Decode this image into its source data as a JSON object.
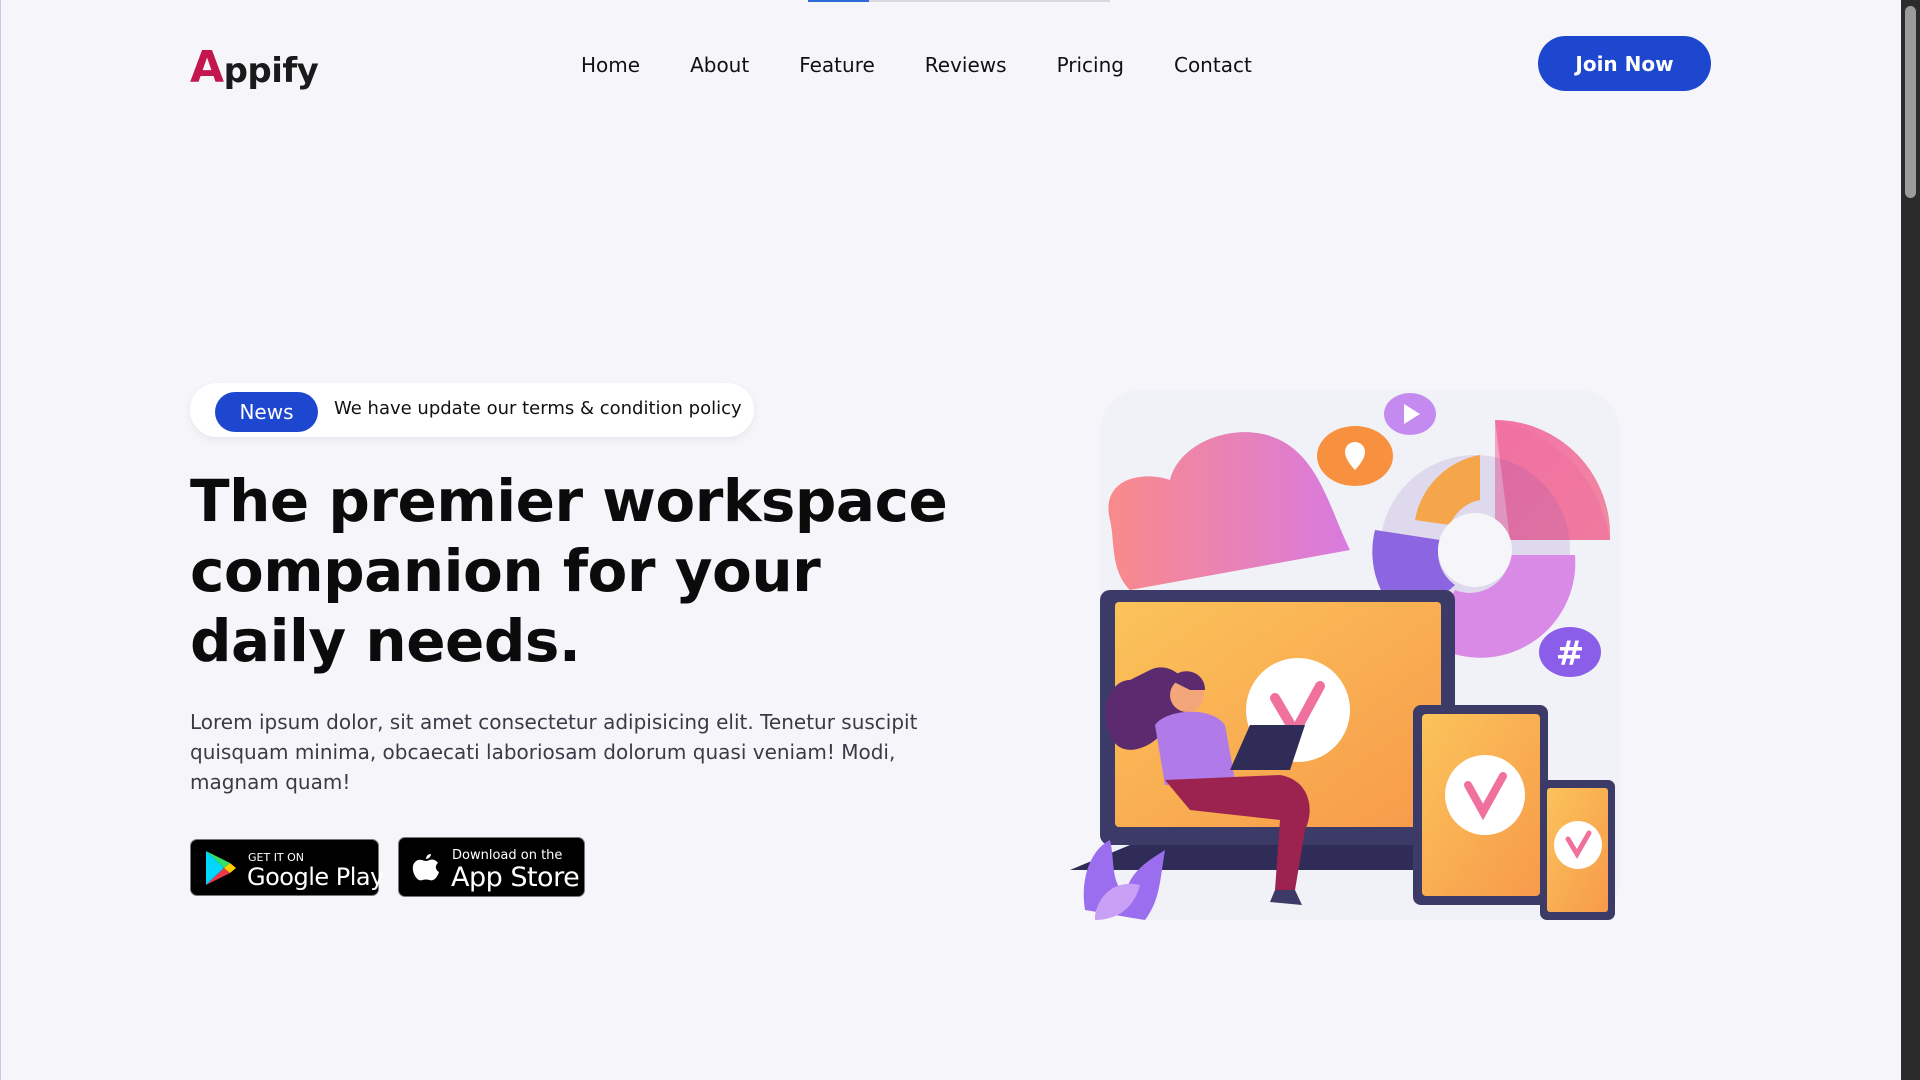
{
  "header": {
    "logo_initial": "A",
    "logo_rest": "ppify",
    "nav": [
      "Home",
      "About",
      "Feature",
      "Reviews",
      "Pricing",
      "Contact"
    ],
    "cta_label": "Join Now"
  },
  "news": {
    "badge": "News",
    "text": "We have update our terms & condition policy"
  },
  "hero": {
    "title": "The premier workspace companion for your daily needs.",
    "description": "Lorem ipsum dolor, sit amet consectetur adipisicing elit. Tenetur suscipit quisquam minima, obcaecati laboriosam dolorum quasi veniam! Modi, magnam quam!"
  },
  "stores": {
    "google_small": "GET IT ON",
    "google_big": "Google Play",
    "apple_small": "Download on the",
    "apple_big": "App Store"
  },
  "colors": {
    "accent": "#1e47d0",
    "logo_accent": "#c3164f",
    "background": "#f6f6fa"
  },
  "icons": {
    "illustration": "workspace-devices-illustration",
    "google_play": "google-play-icon",
    "apple": "apple-icon"
  }
}
